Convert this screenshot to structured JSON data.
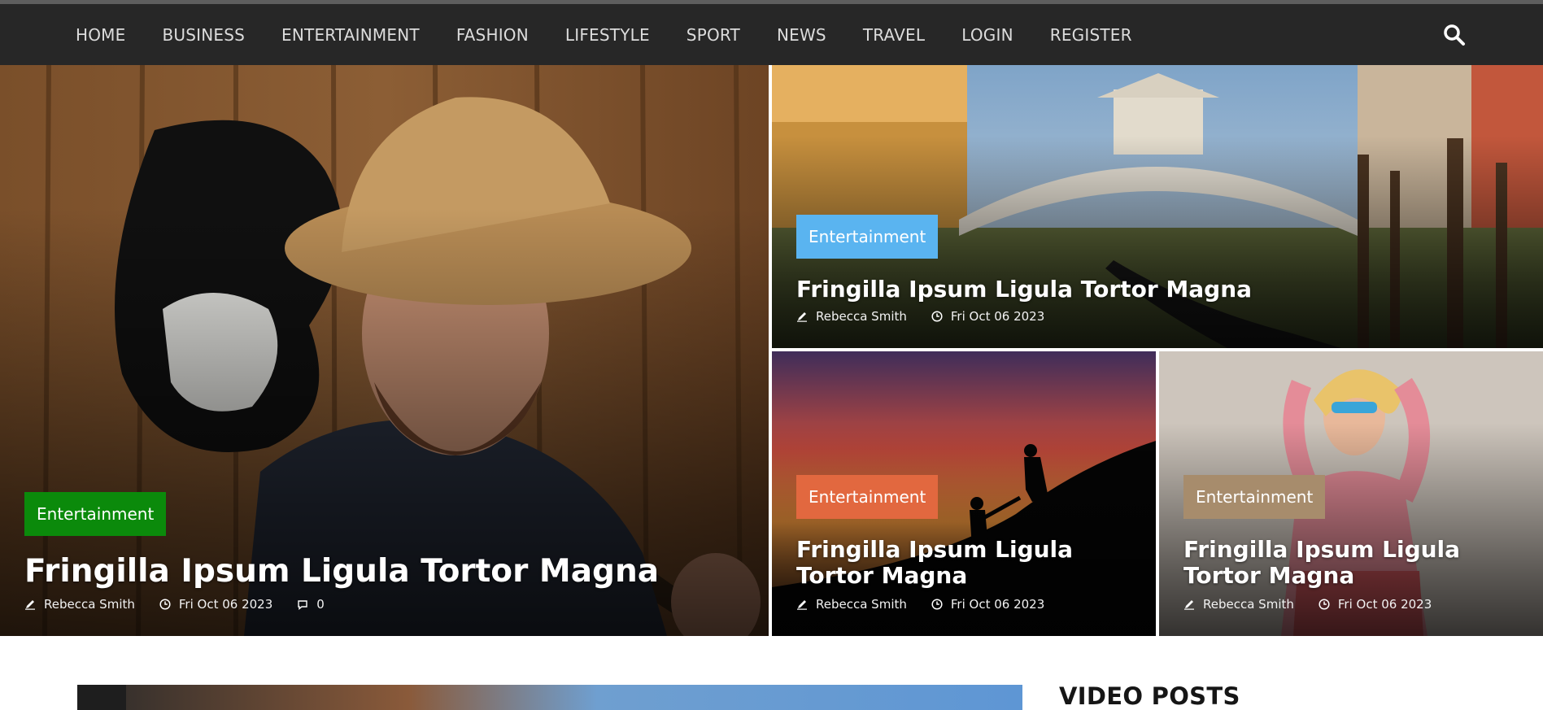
{
  "nav": {
    "items": [
      "HOME",
      "BUSINESS",
      "ENTERTAINMENT",
      "FASHION",
      "LIFESTYLE",
      "SPORT",
      "NEWS",
      "TRAVEL",
      "LOGIN",
      "REGISTER"
    ],
    "search_icon": "search-icon"
  },
  "colors": {
    "nav_bg": "#272727",
    "badge_green": "#0b8a0b",
    "badge_blue": "#5ab4f0",
    "badge_orange": "#e2683f",
    "badge_tan": "#a78c6c"
  },
  "hero": {
    "main": {
      "category": "Entertainment",
      "title": "Fringilla Ipsum Ligula Tortor Magna",
      "author": "Rebecca Smith",
      "date": "Fri Oct 06 2023",
      "comments": "0"
    },
    "top": {
      "category": "Entertainment",
      "title": "Fringilla Ipsum Ligula Tortor Magna",
      "author": "Rebecca Smith",
      "date": "Fri Oct 06 2023"
    },
    "bottom_left": {
      "category": "Entertainment",
      "title": "Fringilla Ipsum Ligula Tortor Magna",
      "author": "Rebecca Smith",
      "date": "Fri Oct 06 2023"
    },
    "bottom_right": {
      "category": "Entertainment",
      "title": "Fringilla Ipsum Ligula Tortor Magna",
      "author": "Rebecca Smith",
      "date": "Fri Oct 06 2023"
    }
  },
  "video_section": {
    "title": "VIDEO POSTS"
  }
}
